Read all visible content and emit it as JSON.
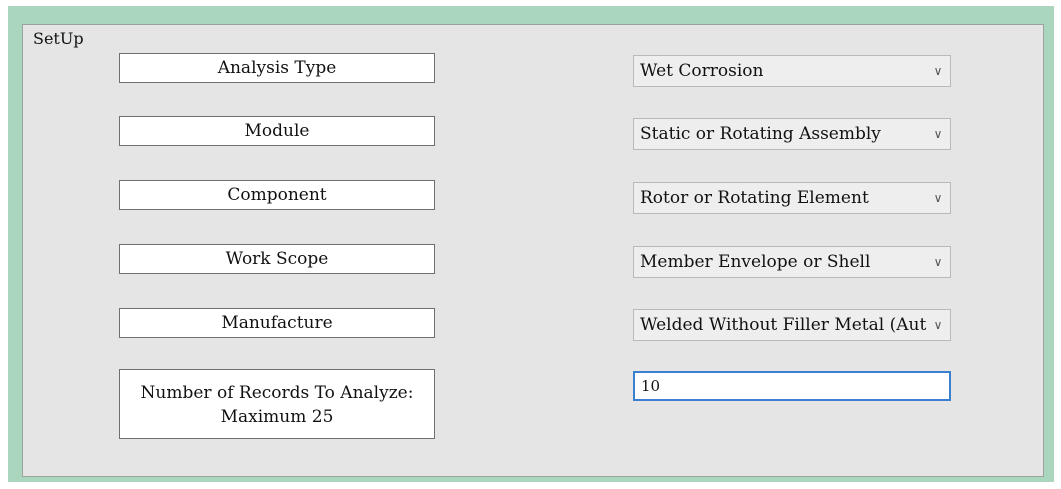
{
  "panel": {
    "title": "SetUp"
  },
  "labels": {
    "analysis_type": "Analysis Type",
    "module": "Module",
    "component": "Component",
    "work_scope": "Work Scope",
    "manufacture": "Manufacture",
    "records_line1": "Number of Records To Analyze:",
    "records_line2": "Maximum 25"
  },
  "selects": {
    "analysis_type": "Wet Corrosion",
    "module": "Static or Rotating Assembly",
    "component": "Rotor or Rotating Element",
    "work_scope": "Member Envelope or Shell",
    "manufacture": "Welded Without Filler Metal (Auto"
  },
  "records_input": {
    "value": "10"
  },
  "icons": {
    "dropdown": "chevron-down-icon"
  },
  "colors": {
    "frame": "#a9d6bd",
    "panel": "#e5e5e5",
    "focus_border": "#3c7fd0"
  }
}
